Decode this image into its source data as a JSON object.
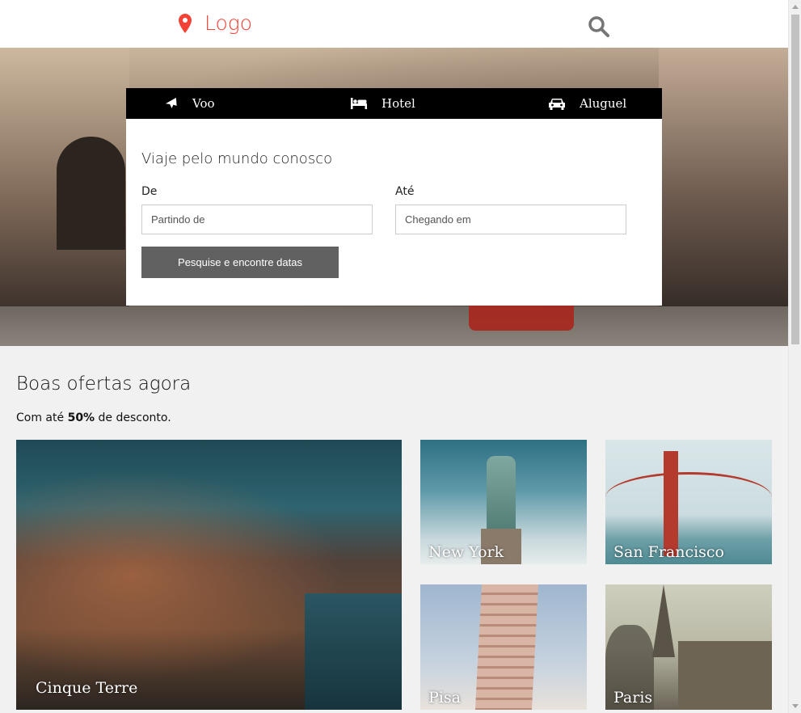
{
  "header": {
    "logo_label": "Logo",
    "logo_icon": "map-marker-icon",
    "search_icon": "search-icon",
    "brand_color": "#f44336"
  },
  "booking": {
    "tabs": [
      {
        "label": "Voo",
        "icon": "plane-icon"
      },
      {
        "label": "Hotel",
        "icon": "bed-icon"
      },
      {
        "label": "Aluguel",
        "icon": "car-icon"
      }
    ],
    "title": "Viaje pelo mundo conosco",
    "from_label": "De",
    "from_placeholder": "Partindo de",
    "to_label": "Até",
    "to_placeholder": "Chegando em",
    "search_button": "Pesquise e encontre datas"
  },
  "offers": {
    "title": "Boas ofertas agora",
    "subtitle_prefix": "Com até",
    "subtitle_bold": "50%",
    "subtitle_suffix": "de desconto.",
    "cards": [
      {
        "name": "Cinque Terre"
      },
      {
        "name": "New York"
      },
      {
        "name": "San Francisco"
      },
      {
        "name": "Pisa"
      },
      {
        "name": "Paris"
      }
    ]
  }
}
